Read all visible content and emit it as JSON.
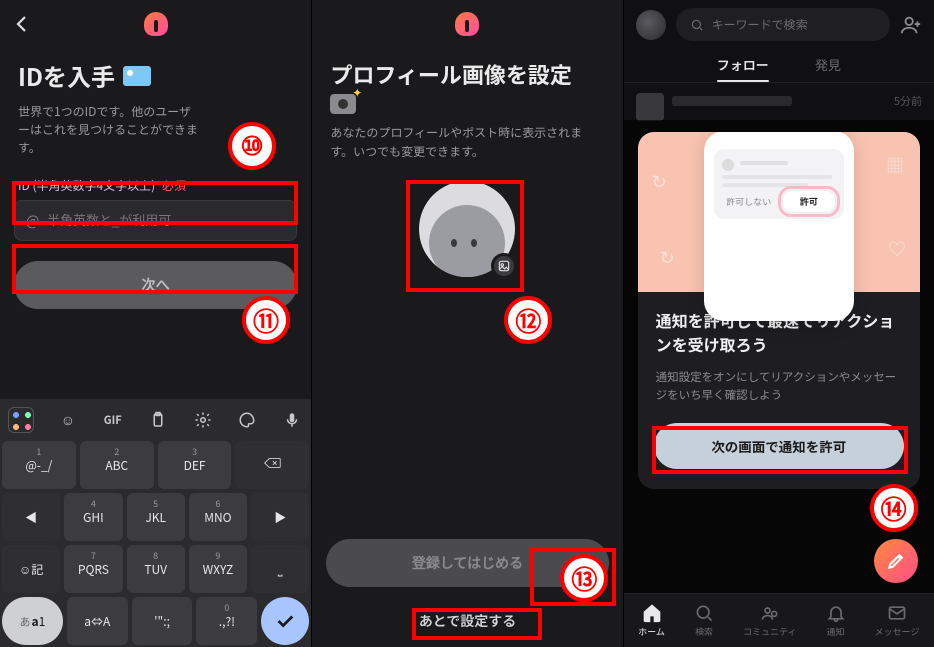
{
  "screen1": {
    "title": "IDを入手",
    "desc": "世界で1つのIDです。他のユーザーはこれを見つけることができます。",
    "field_label": "ID (半角英数字4文字以上)",
    "required": "必須",
    "placeholder": "半角英数と_が利用可",
    "next": "次へ",
    "keyboard": {
      "toolbar_icons": [
        "grid",
        "emoji",
        "gif",
        "clipboard",
        "settings",
        "palette",
        "mic"
      ],
      "rows": [
        [
          {
            "n": "1",
            "main": "@",
            "sub": "@-_/"
          },
          {
            "n": "2",
            "main": "ABC",
            "sub": ""
          },
          {
            "n": "3",
            "main": "DEF",
            "sub": ""
          },
          {
            "n": "",
            "main": "bksp",
            "sub": ""
          }
        ],
        [
          {
            "n": "",
            "main": "←",
            "sub": ""
          },
          {
            "n": "4",
            "main": "GHI",
            "sub": ""
          },
          {
            "n": "5",
            "main": "JKL",
            "sub": ""
          },
          {
            "n": "6",
            "main": "MNO",
            "sub": ""
          },
          {
            "n": "",
            "main": "→",
            "sub": ""
          }
        ],
        [
          {
            "n": "",
            "main": "☺記",
            "sub": ""
          },
          {
            "n": "7",
            "main": "PQRS",
            "sub": ""
          },
          {
            "n": "8",
            "main": "TUV",
            "sub": ""
          },
          {
            "n": "9",
            "main": "WXYZ",
            "sub": ""
          },
          {
            "n": "",
            "main": "␣",
            "sub": ""
          }
        ],
        [
          {
            "n": "",
            "main": "あa1",
            "sub": ""
          },
          {
            "n": "",
            "main": "a⇔A",
            "sub": ""
          },
          {
            "n": "",
            "main": "'\":;",
            "sub": ""
          },
          {
            "n": "0",
            "main": ".,?!",
            "sub": ""
          },
          {
            "n": "",
            "main": "enter",
            "sub": ""
          }
        ]
      ]
    }
  },
  "screen2": {
    "title": "プロフィール画像を設定",
    "desc": "あなたのプロフィールやポスト時に表示されます。いつでも変更できます。",
    "primary": "登録してはじめる",
    "skip": "あとで設定する"
  },
  "screen3": {
    "search_placeholder": "キーワードで検索",
    "tabs": {
      "follow": "フォロー",
      "discover": "発見"
    },
    "feed_time": "5分前",
    "card": {
      "deny_label": "許可しない",
      "allow_label": "許可",
      "title": "通知を許可して最速でリアクションを受け取ろう",
      "desc": "通知設定をオンにしてリアクションやメッセージをいち早く確認しよう",
      "cta": "次の画面で通知を許可"
    },
    "nav": {
      "home": "ホーム",
      "search": "検索",
      "community": "コミュニティ",
      "notif": "通知",
      "message": "メッセージ"
    }
  },
  "annotations": {
    "a10": "⑩",
    "a11": "⑪",
    "a12": "⑫",
    "a13": "⑬",
    "a14": "⑭"
  }
}
